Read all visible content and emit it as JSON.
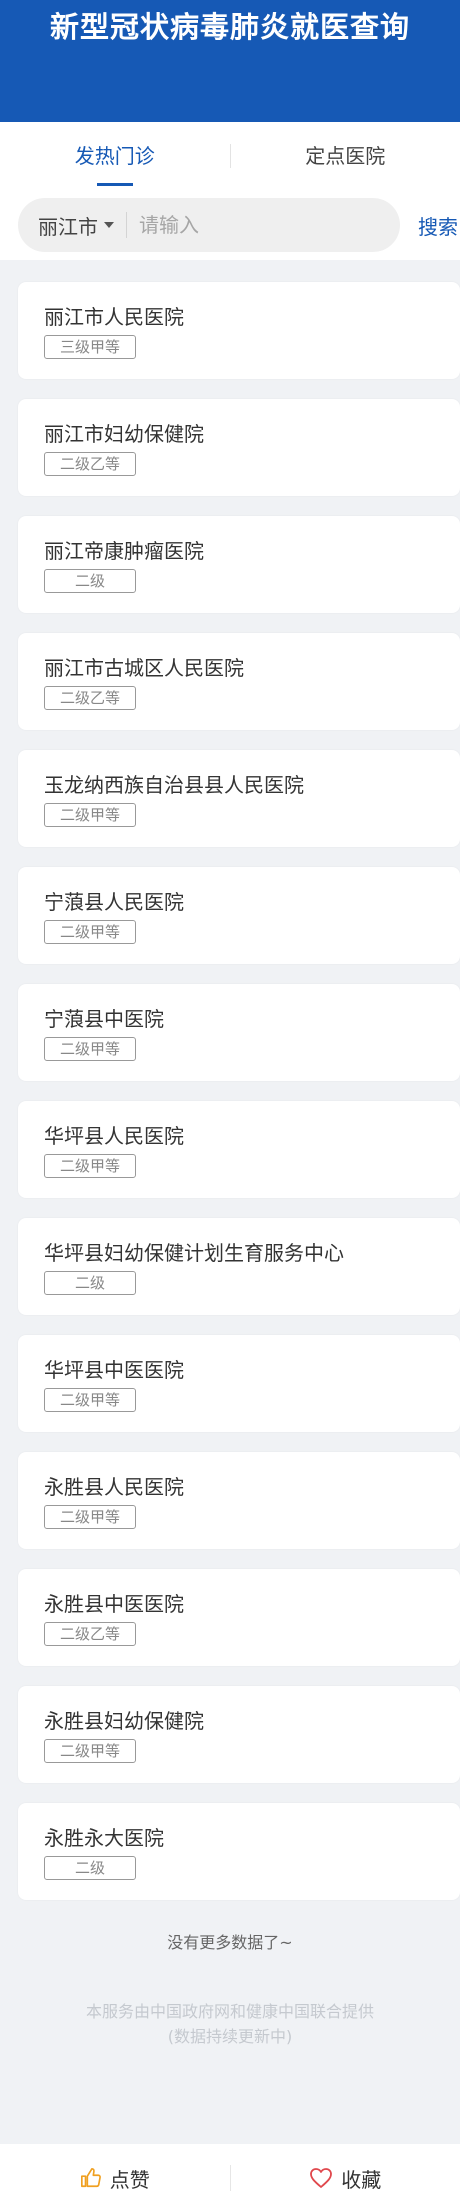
{
  "header": {
    "title": "新型冠状病毒肺炎就医查询"
  },
  "tabs": [
    {
      "label": "发热门诊",
      "active": true
    },
    {
      "label": "定点医院",
      "active": false
    }
  ],
  "search": {
    "city": "丽江市",
    "placeholder": "请输入",
    "button_label": "搜索"
  },
  "hospitals": [
    {
      "name": "丽江市人民医院",
      "level": "三级甲等"
    },
    {
      "name": "丽江市妇幼保健院",
      "level": "二级乙等"
    },
    {
      "name": "丽江帝康肿瘤医院",
      "level": "二级"
    },
    {
      "name": "丽江市古城区人民医院",
      "level": "二级乙等"
    },
    {
      "name": "玉龙纳西族自治县县人民医院",
      "level": "二级甲等"
    },
    {
      "name": "宁蒗县人民医院",
      "level": "二级甲等"
    },
    {
      "name": "宁蒗县中医院",
      "level": "二级甲等"
    },
    {
      "name": "华坪县人民医院",
      "level": "二级甲等"
    },
    {
      "name": "华坪县妇幼保健计划生育服务中心",
      "level": "二级"
    },
    {
      "name": "华坪县中医医院",
      "level": "二级甲等"
    },
    {
      "name": "永胜县人民医院",
      "level": "二级甲等"
    },
    {
      "name": "永胜县中医医院",
      "level": "二级乙等"
    },
    {
      "name": "永胜县妇幼保健院",
      "level": "二级甲等"
    },
    {
      "name": "永胜永大医院",
      "level": "二级"
    }
  ],
  "no_more": "没有更多数据了~",
  "footnote": {
    "line1": "本服务由中国政府网和健康中国联合提供",
    "line2": "(数据持续更新中)"
  },
  "bottom_bar": {
    "like_label": "点赞",
    "like_icon": "thumbs-up-icon",
    "favorite_label": "收藏",
    "favorite_icon": "heart-icon"
  },
  "colors": {
    "brand": "#1659b5",
    "favorite_icon": "#e0474c",
    "like_icon": "#f0a020"
  }
}
